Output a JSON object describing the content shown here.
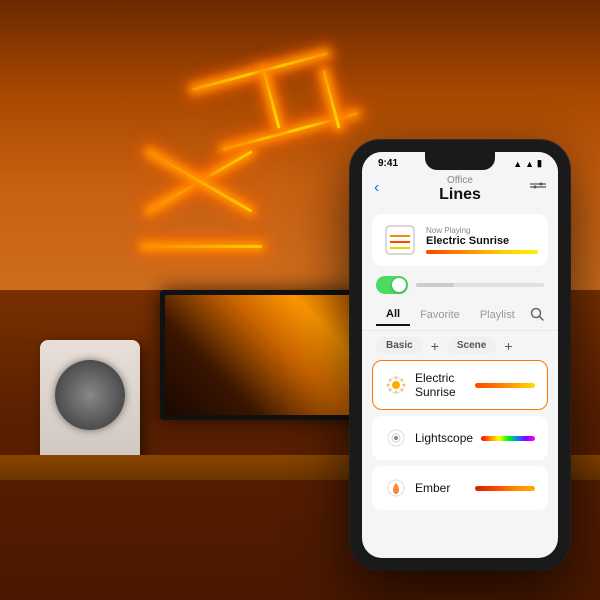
{
  "room": {
    "alt": "Smart home room with LED light strips on wall, desk with speaker and monitor"
  },
  "phone": {
    "status_bar": {
      "time": "9:41",
      "icons": "●●● ▲ ⬛"
    },
    "header": {
      "location": "Office",
      "title": "Lines",
      "back_icon": "‹",
      "filter_icon": "⊕"
    },
    "now_playing": {
      "label": "Now Playing",
      "title": "Electric Sunrise"
    },
    "tabs": [
      {
        "label": "All",
        "active": true
      },
      {
        "label": "Favorite",
        "active": false
      },
      {
        "label": "Playlist",
        "active": false
      }
    ],
    "categories": [
      {
        "label": "Basic"
      },
      {
        "label": "Scene"
      }
    ],
    "scenes": [
      {
        "name": "Electric Sunrise",
        "gradient": "sunrise",
        "selected": true
      },
      {
        "name": "Lightscope",
        "gradient": "lightscope",
        "selected": false
      },
      {
        "name": "Ember",
        "gradient": "ember",
        "selected": false
      }
    ]
  },
  "icons": {
    "back": "‹",
    "filter": "⊕",
    "search": "⌕",
    "add": "+",
    "leaf": "🍂"
  }
}
